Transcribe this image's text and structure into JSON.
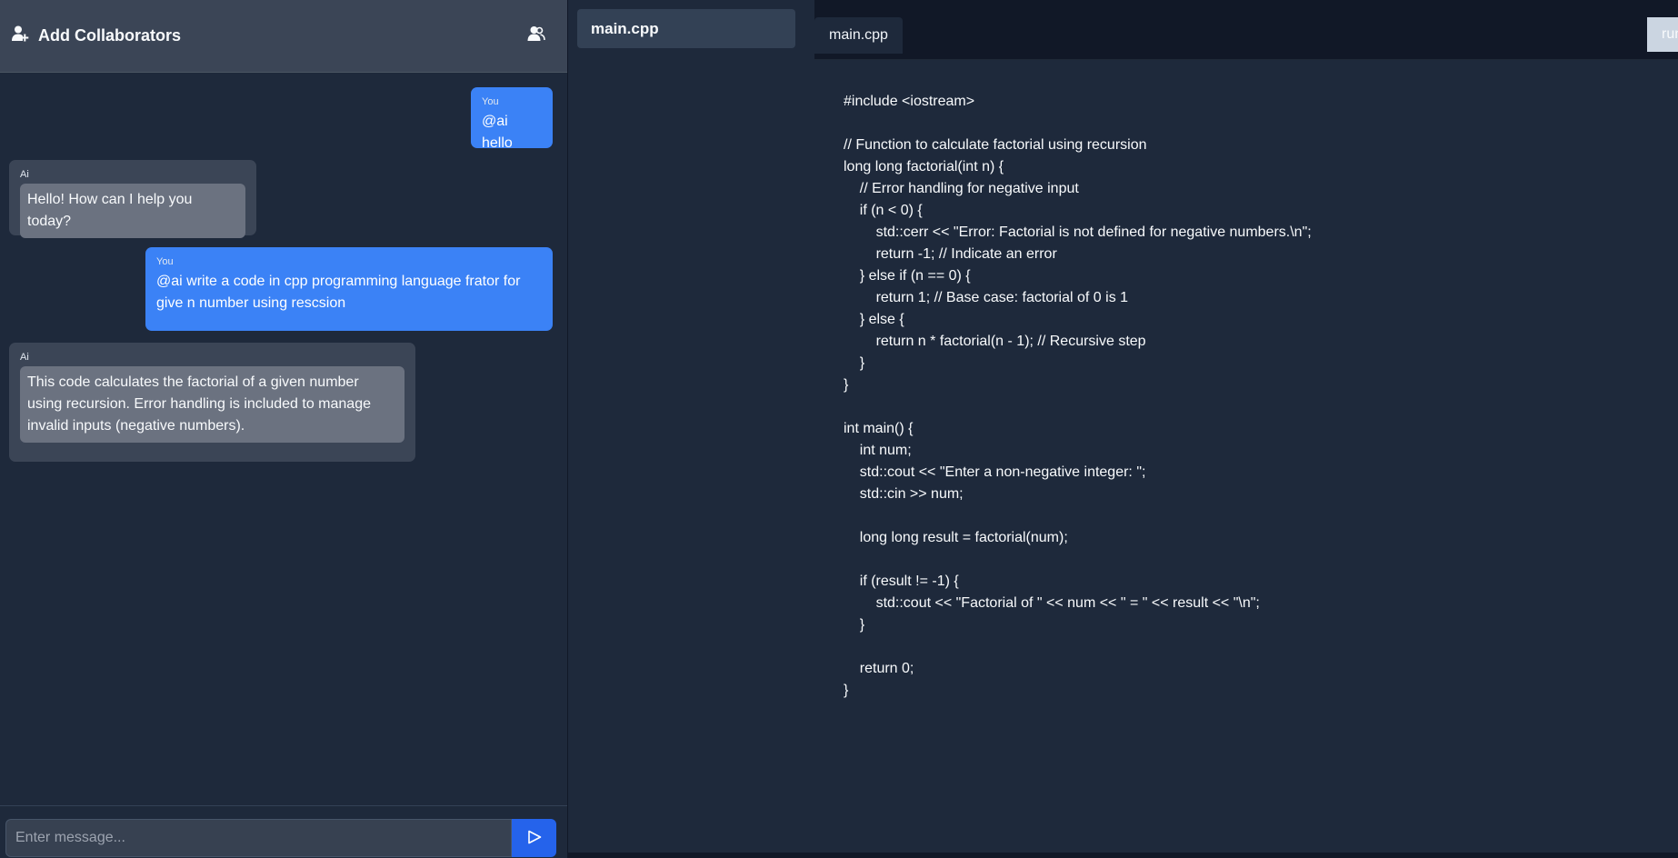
{
  "chat": {
    "header_title": "Add Collaborators",
    "header_left_icon": "user-plus-icon",
    "header_right_icon": "users-icon",
    "messages": [
      {
        "sender": "You",
        "text": "@ai hello"
      },
      {
        "sender": "Ai",
        "text": "Hello! How can I help you today?"
      },
      {
        "sender": "You",
        "text": "@ai write a code in cpp programming language frator for give n number using rescsion"
      },
      {
        "sender": "Ai",
        "text": "This code calculates the factorial of a given number using recursion. Error handling is included to manage invalid inputs (negative numbers)."
      }
    ],
    "input_placeholder": "Enter message...",
    "send_icon": "send-icon"
  },
  "explorer": {
    "files": [
      {
        "name": "main.cpp"
      }
    ]
  },
  "editor": {
    "tabs": [
      {
        "label": "main.cpp"
      }
    ],
    "run_label": "run",
    "code": "#include <iostream>\n\n// Function to calculate factorial using recursion\nlong long factorial(int n) {\n    // Error handling for negative input\n    if (n < 0) {\n        std::cerr << \"Error: Factorial is not defined for negative numbers.\\n\";\n        return -1; // Indicate an error\n    } else if (n == 0) {\n        return 1; // Base case: factorial of 0 is 1\n    } else {\n        return n * factorial(n - 1); // Recursive step\n    }\n}\n\nint main() {\n    int num;\n    std::cout << \"Enter a non-negative integer: \";\n    std::cin >> num;\n\n    long long result = factorial(num);\n\n    if (result != -1) {\n        std::cout << \"Factorial of \" << num << \" = \" << result << \"\\n\";\n    }\n\n    return 0;\n}"
  },
  "colors": {
    "user_bubble": "#3b82f6",
    "ai_bubble": "#3b4556",
    "send_button": "#2563eb",
    "panel_bg": "#1e293b"
  }
}
